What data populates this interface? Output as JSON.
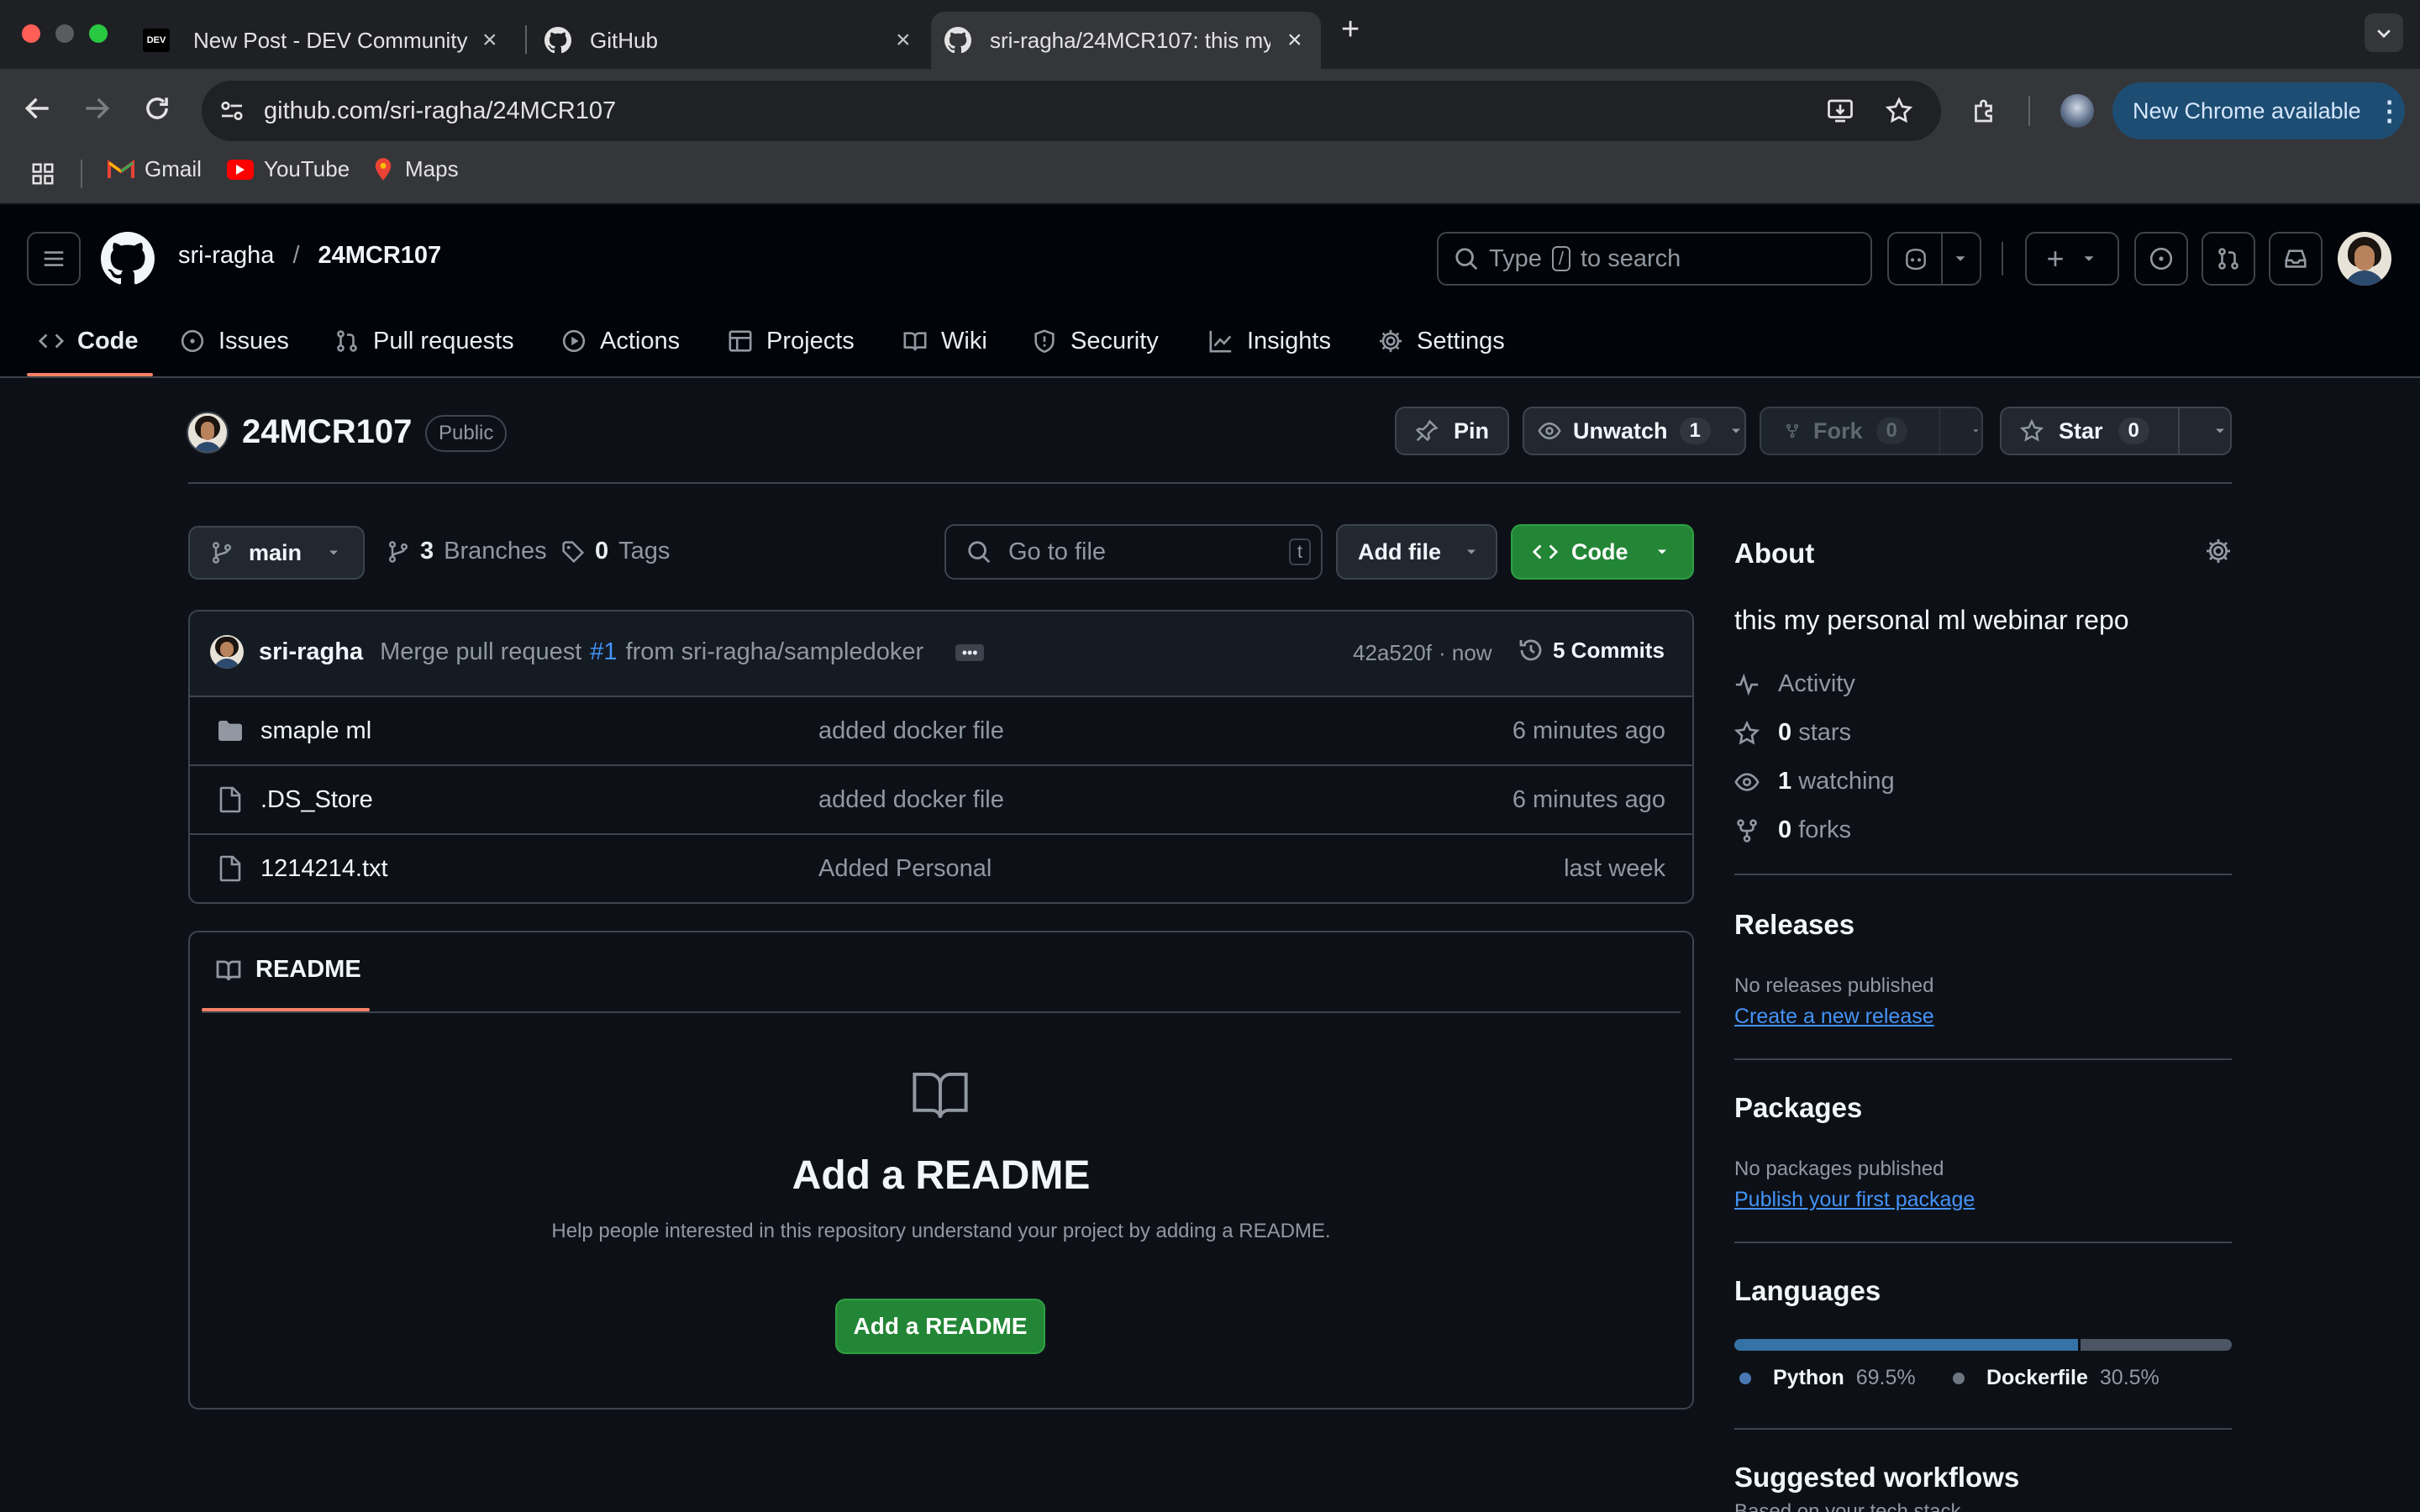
{
  "browser": {
    "tabs": [
      {
        "title": "New Post - DEV Community",
        "favicon": "dev-logo"
      },
      {
        "title": "GitHub",
        "favicon": "github-logo"
      },
      {
        "title": "sri-ragha/24MCR107: this my",
        "favicon": "github-logo",
        "active": true
      }
    ],
    "url": "github.com/sri-ragha/24MCR107",
    "update_button": "New Chrome available",
    "bookmarks": [
      "Gmail",
      "YouTube",
      "Maps"
    ]
  },
  "header": {
    "owner": "sri-ragha",
    "separator": "/",
    "repo": "24MCR107",
    "search_prefix": "Type",
    "search_key": "/",
    "search_suffix": "to search"
  },
  "nav": [
    {
      "label": "Code",
      "icon": "code-icon",
      "active": true
    },
    {
      "label": "Issues",
      "icon": "issue-icon"
    },
    {
      "label": "Pull requests",
      "icon": "pull-request-icon"
    },
    {
      "label": "Actions",
      "icon": "play-icon"
    },
    {
      "label": "Projects",
      "icon": "table-icon"
    },
    {
      "label": "Wiki",
      "icon": "book-icon"
    },
    {
      "label": "Security",
      "icon": "shield-icon"
    },
    {
      "label": "Insights",
      "icon": "graph-icon"
    },
    {
      "label": "Settings",
      "icon": "gear-icon"
    }
  ],
  "repo": {
    "name": "24MCR107",
    "visibility": "Public",
    "pin": "Pin",
    "unwatch": "Unwatch",
    "watch_count": "1",
    "fork": "Fork",
    "fork_count": "0",
    "star": "Star",
    "star_count": "0"
  },
  "toolbar": {
    "branch": "main",
    "branches_count": "3",
    "branches_label": "Branches",
    "tags_count": "0",
    "tags_label": "Tags",
    "goto_placeholder": "Go to file",
    "goto_key": "t",
    "add_file": "Add file",
    "code": "Code"
  },
  "commit": {
    "author": "sri-ragha",
    "message_prefix": "Merge pull request",
    "pr_link": "#1",
    "message_suffix": "from sri-ragha/sampledoker",
    "hash": "42a520f",
    "time": "· now",
    "commits": "5 Commits"
  },
  "files": [
    {
      "name": "smaple ml",
      "type": "folder",
      "message": "added docker file",
      "age": "6 minutes ago"
    },
    {
      "name": ".DS_Store",
      "type": "file",
      "message": "added docker file",
      "age": "6 minutes ago"
    },
    {
      "name": "1214214.txt",
      "type": "file",
      "message": "Added Personal",
      "age": "last week"
    }
  ],
  "readme": {
    "tab": "README",
    "title": "Add a README",
    "description": "Help people interested in this repository understand your project by adding a README.",
    "button": "Add a README"
  },
  "about": {
    "heading": "About",
    "description": "this my personal ml webinar repo",
    "activity": "Activity",
    "stars_count": "0",
    "stars_label": "stars",
    "watching_count": "1",
    "watching_label": "watching",
    "forks_count": "0",
    "forks_label": "forks"
  },
  "releases": {
    "heading": "Releases",
    "text": "No releases published",
    "link": "Create a new release"
  },
  "packages": {
    "heading": "Packages",
    "text": "No packages published",
    "link": "Publish your first package"
  },
  "languages": {
    "heading": "Languages",
    "items": [
      {
        "name": "Python",
        "percent": "69.5%",
        "value": 69.5,
        "color": "#3572A5"
      },
      {
        "name": "Dockerfile",
        "percent": "30.5%",
        "value": 30.5,
        "color": "#384d54"
      }
    ]
  },
  "suggested": {
    "heading": "Suggested workflows",
    "subtext": "Based on your tech stack"
  }
}
